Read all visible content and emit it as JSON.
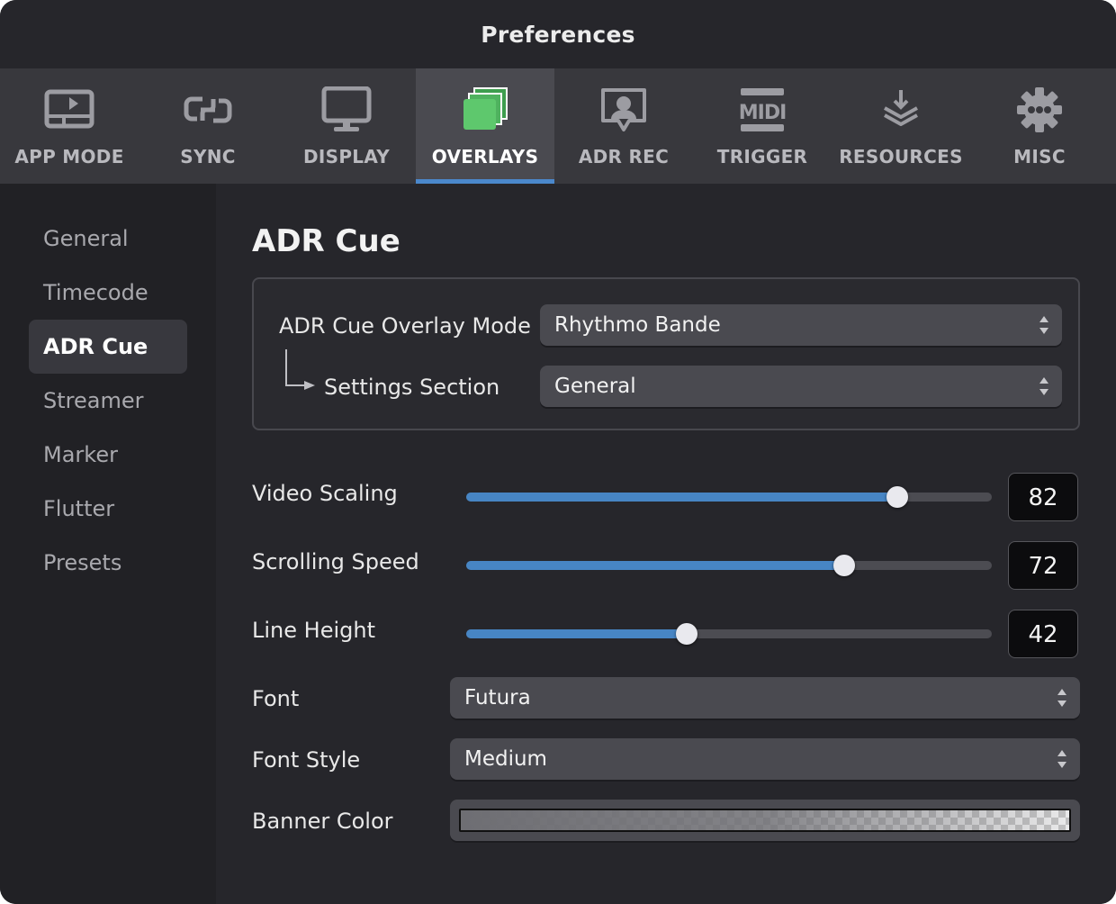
{
  "window": {
    "title": "Preferences"
  },
  "toolbar": {
    "tabs": [
      {
        "label": "APP MODE",
        "icon": "app-mode-icon"
      },
      {
        "label": "SYNC",
        "icon": "sync-icon"
      },
      {
        "label": "DISPLAY",
        "icon": "display-icon"
      },
      {
        "label": "OVERLAYS",
        "icon": "overlays-icon",
        "active": true
      },
      {
        "label": "ADR REC",
        "icon": "adr-rec-icon"
      },
      {
        "label": "TRIGGER",
        "icon": "midi-icon"
      },
      {
        "label": "RESOURCES",
        "icon": "resources-icon"
      },
      {
        "label": "MISC",
        "icon": "gear-icon"
      }
    ],
    "accent": "#4b88cc"
  },
  "sidebar": {
    "items": [
      {
        "label": "General"
      },
      {
        "label": "Timecode"
      },
      {
        "label": "ADR Cue",
        "active": true
      },
      {
        "label": "Streamer"
      },
      {
        "label": "Marker"
      },
      {
        "label": "Flutter"
      },
      {
        "label": "Presets"
      }
    ]
  },
  "main": {
    "title": "ADR Cue",
    "overlay_mode": {
      "label": "ADR Cue Overlay Mode",
      "value": "Rhythmo Bande"
    },
    "settings_section": {
      "label": "Settings Section",
      "value": "General"
    },
    "video_scaling": {
      "label": "Video Scaling",
      "value": "82",
      "level": 0.82
    },
    "scrolling_speed": {
      "label": "Scrolling Speed",
      "value": "72",
      "level": 0.72
    },
    "line_height": {
      "label": "Line Height",
      "value": "42",
      "level": 0.42
    },
    "font": {
      "label": "Font",
      "value": "Futura"
    },
    "font_style": {
      "label": "Font Style",
      "value": "Medium"
    },
    "banner_color": {
      "label": "Banner Color"
    },
    "slider_color": "#4785c4"
  }
}
